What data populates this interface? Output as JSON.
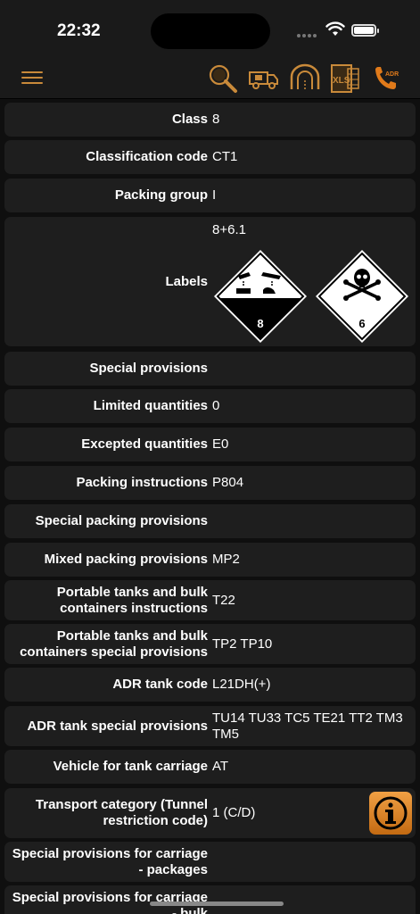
{
  "status": {
    "time": "22:32"
  },
  "rows": [
    {
      "label": "Class",
      "value": "8"
    },
    {
      "label": "Classification code",
      "value": "CT1"
    },
    {
      "label": "Packing group",
      "value": "I"
    },
    {
      "label": "Labels",
      "value": "8+6.1",
      "placards": [
        "8",
        "6"
      ]
    },
    {
      "label": "Special provisions",
      "value": ""
    },
    {
      "label": "Limited quantities",
      "value": "0"
    },
    {
      "label": "Excepted quantities",
      "value": "E0"
    },
    {
      "label": "Packing instructions",
      "value": "P804"
    },
    {
      "label": "Special packing provisions",
      "value": ""
    },
    {
      "label": "Mixed packing provisions",
      "value": "MP2"
    },
    {
      "label": "Portable tanks and bulk containers instructions",
      "value": "T22"
    },
    {
      "label": "Portable tanks and bulk containers special provisions",
      "value": "TP2 TP10"
    },
    {
      "label": "ADR tank code",
      "value": "L21DH(+)"
    },
    {
      "label": "ADR tank special provisions",
      "value": "TU14 TU33 TC5 TE21 TT2 TM3 TM5"
    },
    {
      "label": "Vehicle for tank carriage",
      "value": "AT"
    },
    {
      "label": "Transport category (Tunnel restriction code)",
      "value": "1 (C/D)"
    },
    {
      "label": "Special provisions for carriage - packages",
      "value": ""
    },
    {
      "label": "Special provisions for carriage - bulk",
      "value": ""
    }
  ],
  "toolbar": {
    "xls_label": "XLS",
    "adr_label": "ADR"
  },
  "colors": {
    "accent": "#c98a3a",
    "row_bg": "#1e1e1e",
    "info_button": "#e38a2a"
  }
}
